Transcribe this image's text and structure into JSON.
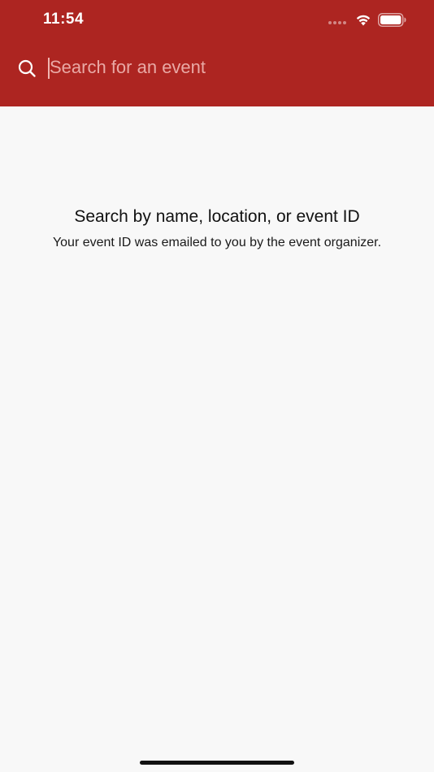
{
  "status_bar": {
    "time": "11:54"
  },
  "search": {
    "placeholder": "Search for an event",
    "value": ""
  },
  "empty_state": {
    "title": "Search by name, location, or event ID",
    "subtitle": "Your event ID was emailed to you by the event organizer."
  },
  "colors": {
    "header_background": "#ad2521",
    "page_background": "#f8f8f8",
    "placeholder_text": "#e9a9a5"
  },
  "icons": {
    "search": "search-icon",
    "wifi": "wifi-icon",
    "battery": "battery-icon",
    "signal": "cellular-signal-icon"
  }
}
